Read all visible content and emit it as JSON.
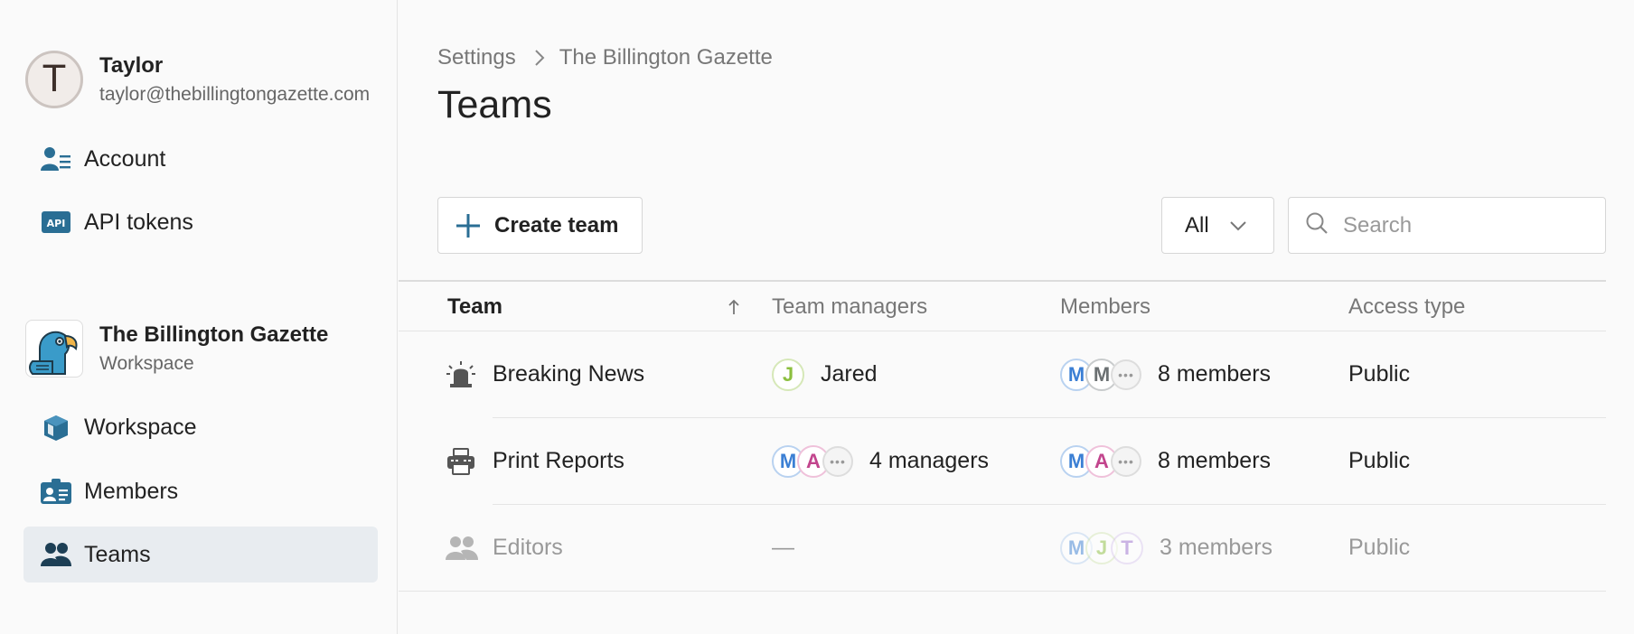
{
  "user": {
    "initial": "T",
    "name": "Taylor",
    "email": "taylor@thebillingtongazette.com"
  },
  "sidebar": {
    "account_items": [
      {
        "label": "Account",
        "icon": "account-icon"
      },
      {
        "label": "API tokens",
        "icon": "api-icon"
      }
    ],
    "workspace": {
      "name": "The Billington Gazette",
      "subtitle": "Workspace",
      "logo": "parrot-logo"
    },
    "workspace_items": [
      {
        "label": "Workspace",
        "icon": "workspace-icon"
      },
      {
        "label": "Members",
        "icon": "members-icon"
      },
      {
        "label": "Teams",
        "icon": "teams-icon",
        "active": true
      }
    ]
  },
  "breadcrumb": {
    "root": "Settings",
    "current": "The Billington Gazette"
  },
  "page": {
    "title": "Teams"
  },
  "toolbar": {
    "create_label": "Create team",
    "filter_value": "All",
    "search_placeholder": "Search"
  },
  "table": {
    "headers": {
      "team": "Team",
      "managers": "Team managers",
      "members": "Members",
      "access": "Access type"
    },
    "rows": [
      {
        "name": "Breaking News",
        "icon": "siren-icon",
        "managers": [
          {
            "initial": "J",
            "color": "#8cbf3f"
          }
        ],
        "managers_label": "Jared",
        "members": [
          {
            "initial": "M",
            "color": "#3b7fd4"
          },
          {
            "initial": "M",
            "color": "#6b7072"
          }
        ],
        "members_label": "8 members",
        "access": "Public"
      },
      {
        "name": "Print Reports",
        "icon": "printer-icon",
        "managers": [
          {
            "initial": "M",
            "color": "#3b7fd4"
          },
          {
            "initial": "A",
            "color": "#c2458d"
          }
        ],
        "managers_label": "4 managers",
        "members": [
          {
            "initial": "M",
            "color": "#3b7fd4"
          },
          {
            "initial": "A",
            "color": "#c2458d"
          }
        ],
        "members_label": "8 members",
        "access": "Public"
      },
      {
        "name": "Editors",
        "icon": "people-icon",
        "managers": [],
        "managers_label": "—",
        "members": [
          {
            "initial": "M",
            "color": "#3b7fd4"
          },
          {
            "initial": "J",
            "color": "#8cbf3f"
          },
          {
            "initial": "T",
            "color": "#9b6fd0"
          }
        ],
        "members_label": "3 members",
        "access": "Public"
      }
    ]
  },
  "colors": {
    "accent": "#2a6e94",
    "active_bg": "#e8ecf0"
  }
}
